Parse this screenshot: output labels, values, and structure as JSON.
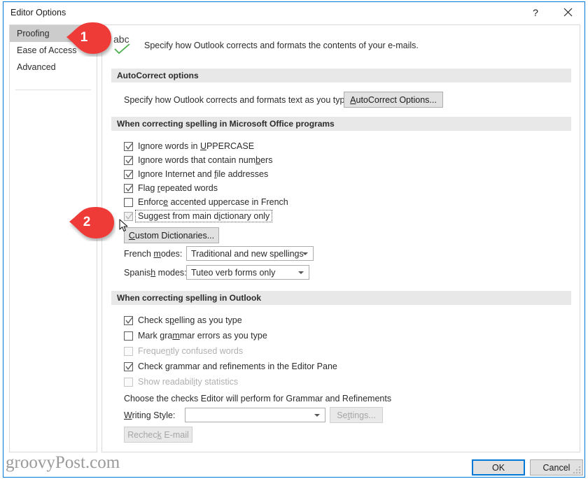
{
  "window": {
    "title": "Editor Options",
    "help_icon": "question-mark-icon",
    "close_icon": "close-icon"
  },
  "nav": {
    "items": [
      {
        "label": "Proofing",
        "selected": true
      },
      {
        "label": "Ease of Access",
        "selected": false
      },
      {
        "label": "Advanced",
        "selected": false
      }
    ]
  },
  "header": {
    "icon_label": "abc",
    "icon_name": "spellcheck-abc-icon",
    "description": "Specify how Outlook corrects and formats the contents of your e-mails."
  },
  "autocorrect_group": {
    "title": "AutoCorrect options",
    "description": "Specify how Outlook corrects and formats text as you type.",
    "button_label": "AutoCorrect Options...",
    "button_accel": "A"
  },
  "office_group": {
    "title": "When correcting spelling in Microsoft Office programs",
    "checkboxes": [
      {
        "label": "Ignore words in UPPERCASE",
        "accel": "U",
        "checked": true,
        "enabled": true,
        "focused": false
      },
      {
        "label": "Ignore words that contain numbers",
        "accel": "b",
        "checked": true,
        "enabled": true,
        "focused": false
      },
      {
        "label": "Ignore Internet and file addresses",
        "accel": "f",
        "checked": true,
        "enabled": true,
        "focused": false
      },
      {
        "label": "Flag repeated words",
        "accel": "r",
        "checked": true,
        "enabled": true,
        "focused": false
      },
      {
        "label": "Enforce accented uppercase in French",
        "accel": "e",
        "checked": false,
        "enabled": true,
        "focused": false
      },
      {
        "label": "Suggest from main dictionary only",
        "accel": "i",
        "checked": true,
        "enabled": true,
        "focused": true
      }
    ],
    "custom_dictionaries_label": "Custom Dictionaries...",
    "custom_dictionaries_accel": "C",
    "french_modes_label": "French modes:",
    "french_modes_accel": "m",
    "french_modes_value": "Traditional and new spellings",
    "spanish_modes_label": "Spanish modes:",
    "spanish_modes_accel": "h",
    "spanish_modes_value": "Tuteo verb forms only"
  },
  "outlook_group": {
    "title": "When correcting spelling in Outlook",
    "checkboxes": [
      {
        "label": "Check spelling as you type",
        "accel": "p",
        "checked": true,
        "enabled": true
      },
      {
        "label": "Mark grammar errors as you type",
        "accel": "m",
        "checked": false,
        "enabled": true
      },
      {
        "label": "Frequently confused words",
        "accel": "n",
        "checked": false,
        "enabled": false
      },
      {
        "label": "Check grammar and refinements in the Editor Pane",
        "accel": "",
        "checked": true,
        "enabled": true
      },
      {
        "label": "Show readability statistics",
        "accel": "i",
        "checked": false,
        "enabled": false
      }
    ],
    "choose_checks_text": "Choose the checks Editor will perform for Grammar and Refinements",
    "writing_style_label": "Writing Style:",
    "writing_style_accel": "W",
    "writing_style_value": "",
    "settings_label": "Settings...",
    "settings_accel": "t",
    "settings_enabled": false,
    "recheck_label": "Recheck E-mail",
    "recheck_accel": "k",
    "recheck_enabled": false
  },
  "footer": {
    "ok_label": "OK",
    "cancel_label": "Cancel"
  },
  "watermark": {
    "text": "groovyPost.com"
  },
  "callouts": [
    {
      "number": "1",
      "color": "#ee3a37"
    },
    {
      "number": "2",
      "color": "#ee3a37"
    }
  ]
}
